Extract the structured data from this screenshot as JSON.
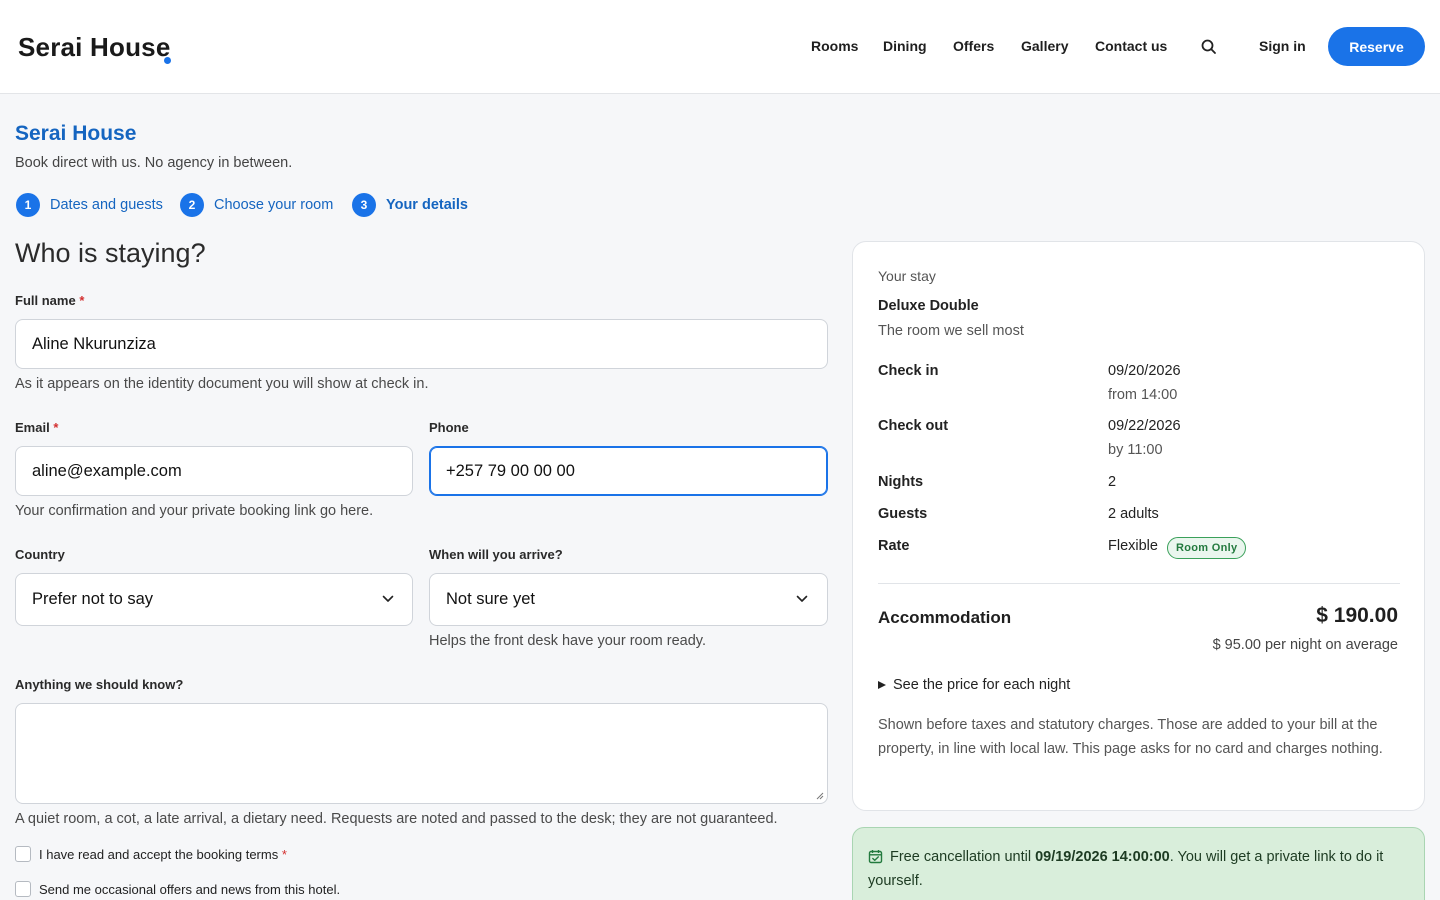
{
  "header": {
    "logo": "Serai House",
    "nav": [
      "Rooms",
      "Dining",
      "Offers",
      "Gallery",
      "Contact us"
    ],
    "sign_in": "Sign in",
    "reserve": "Reserve"
  },
  "intro": {
    "title": "Serai House",
    "subtitle": "Book direct with us. No agency in between."
  },
  "steps": [
    {
      "num": "1",
      "label": "Dates and guests"
    },
    {
      "num": "2",
      "label": "Choose your room"
    },
    {
      "num": "3",
      "label": "Your details"
    }
  ],
  "form": {
    "heading": "Who is staying?",
    "full_name": {
      "label": "Full name",
      "required": "*",
      "value": "Aline Nkurunziza",
      "hint": "As it appears on the identity document you will show at check in."
    },
    "email": {
      "label": "Email",
      "required": "*",
      "value": "aline@example.com",
      "hint": "Your confirmation and your private booking link go here."
    },
    "phone": {
      "label": "Phone",
      "value": "+257 79 00 00 00"
    },
    "country": {
      "label": "Country",
      "value": "Prefer not to say"
    },
    "arrival": {
      "label": "When will you arrive?",
      "value": "Not sure yet",
      "hint": "Helps the front desk have your room ready."
    },
    "notes": {
      "label": "Anything we should know?",
      "hint": "A quiet room, a cot, a late arrival, a dietary need. Requests are noted and passed to the desk; they are not guaranteed."
    },
    "terms": {
      "label": "I have read and accept the booking terms",
      "required": "*"
    },
    "offers": {
      "label": "Send me occasional offers and news from this hotel."
    }
  },
  "summary": {
    "eyebrow": "Your stay",
    "room": "Deluxe Double",
    "room_sub": "The room we sell most",
    "check_in_label": "Check in",
    "check_in_date": "09/20/2026",
    "check_in_time": "from 14:00",
    "check_out_label": "Check out",
    "check_out_date": "09/22/2026",
    "check_out_time": "by 11:00",
    "nights_label": "Nights",
    "nights": "2",
    "guests_label": "Guests",
    "guests": "2 adults",
    "rate_label": "Rate",
    "rate": "Flexible",
    "rate_badge": "Room Only",
    "accommodation_label": "Accommodation",
    "total": "$ 190.00",
    "avg": "$ 95.00 per night on average",
    "details_toggle": "See the price for each night",
    "note": "Shown before taxes and statutory charges. Those are added to your bill at the property, in line with local law. This page asks for no card and charges nothing."
  },
  "cancellation": {
    "prefix": "Free cancellation until ",
    "deadline": "09/19/2026 14:00:00",
    "suffix": ". You will get a private link to do it yourself."
  },
  "colors": {
    "accent": "#1a73e8",
    "brand_blue": "#1565c0",
    "success_bg": "#d9eedb",
    "required": "#d32f2f"
  }
}
